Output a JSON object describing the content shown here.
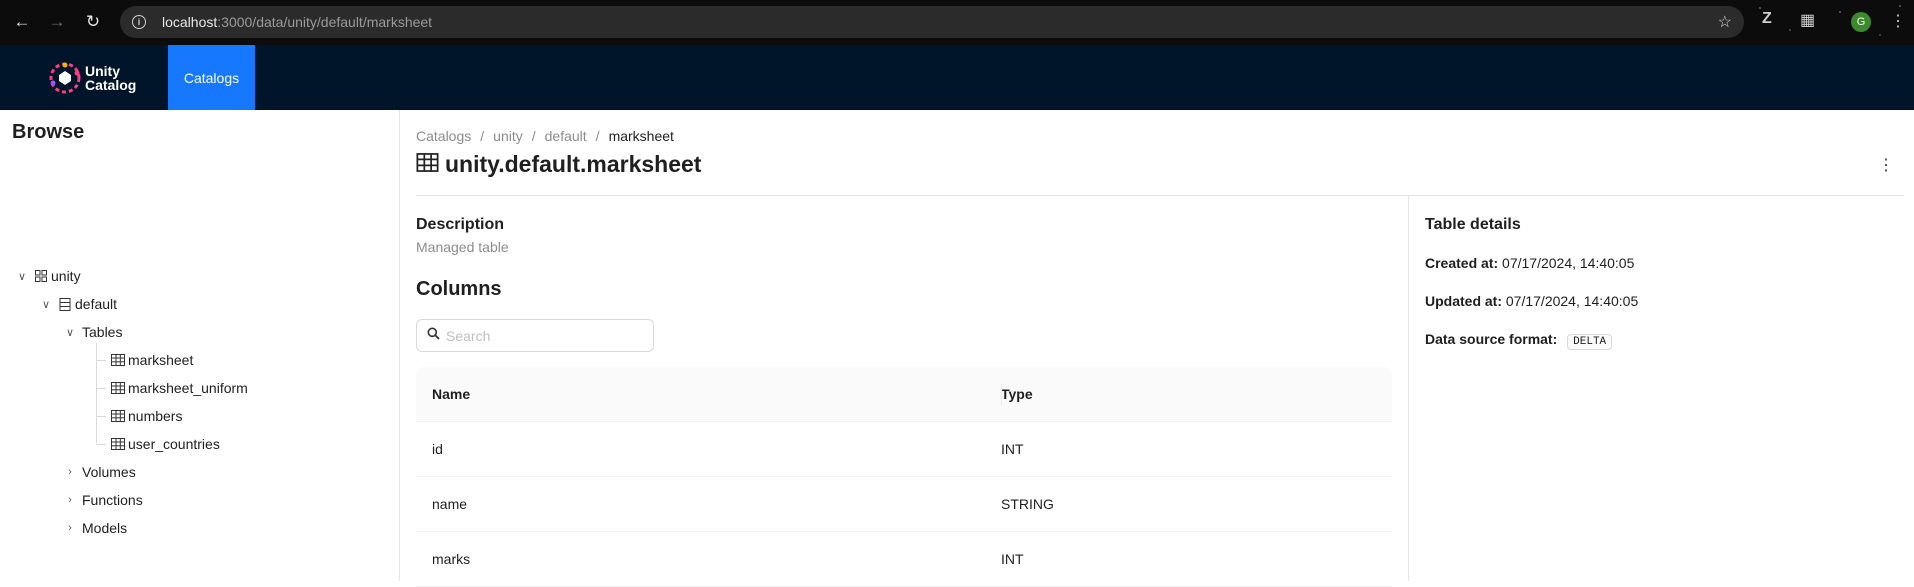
{
  "browser": {
    "url_host": "localhost",
    "url_rest": ":3000/data/unity/default/marksheet",
    "profile_initial": "G"
  },
  "app": {
    "logo_line1": "Unity",
    "logo_line2": "Catalog",
    "nav_tab": "Catalogs",
    "accent": "#1677ff",
    "header_bg": "#001529"
  },
  "sidebar": {
    "title": "Browse",
    "catalog": "unity",
    "schema": "default",
    "tables_group": "Tables",
    "tables": [
      "marksheet",
      "marksheet_uniform",
      "numbers",
      "user_countries"
    ],
    "volumes_group": "Volumes",
    "functions_group": "Functions",
    "models_group": "Models"
  },
  "breadcrumb": [
    "Catalogs",
    "unity",
    "default",
    "marksheet"
  ],
  "page_title": "unity.default.marksheet",
  "description": {
    "heading": "Description",
    "value": "Managed table"
  },
  "columns": {
    "heading": "Columns",
    "search_placeholder": "Search",
    "headers": [
      "Name",
      "Type"
    ],
    "rows": [
      {
        "name": "id",
        "type": "INT"
      },
      {
        "name": "name",
        "type": "STRING"
      },
      {
        "name": "marks",
        "type": "INT"
      }
    ]
  },
  "table_details": {
    "heading": "Table details",
    "created_label": "Created at:",
    "created_value": "07/17/2024, 14:40:05",
    "updated_label": "Updated at:",
    "updated_value": "07/17/2024, 14:40:05",
    "format_label": "Data source format:",
    "format_value": "DELTA"
  }
}
